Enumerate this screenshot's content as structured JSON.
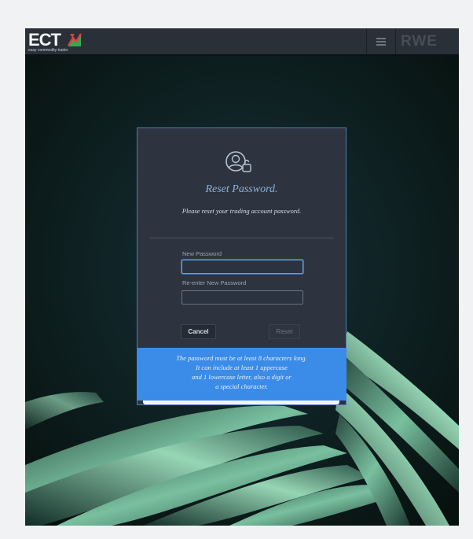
{
  "header": {
    "logo_text": "ECT",
    "logo_tagline": "easy commodity trader",
    "brand_right": "RWE"
  },
  "dialog": {
    "title": "Reset Password.",
    "subtitle": "Please reset your trading account password.",
    "new_password_label": "New Password",
    "new_password_value": "",
    "reenter_label": "Re-enter New Password",
    "reenter_value": "",
    "cancel_label": "Cancel",
    "reset_label": "Reset"
  },
  "hint": {
    "line1": "The password must be at least 8 characters long.",
    "line2": "It can include at least 1 uppercase",
    "line3": "and 1 lowercase letter, also a digit or",
    "line4": "a special character."
  },
  "colors": {
    "header_bg": "#2a3038",
    "dialog_bg": "#2d3440",
    "accent": "#3b8be8",
    "title": "#8fb0d8"
  }
}
